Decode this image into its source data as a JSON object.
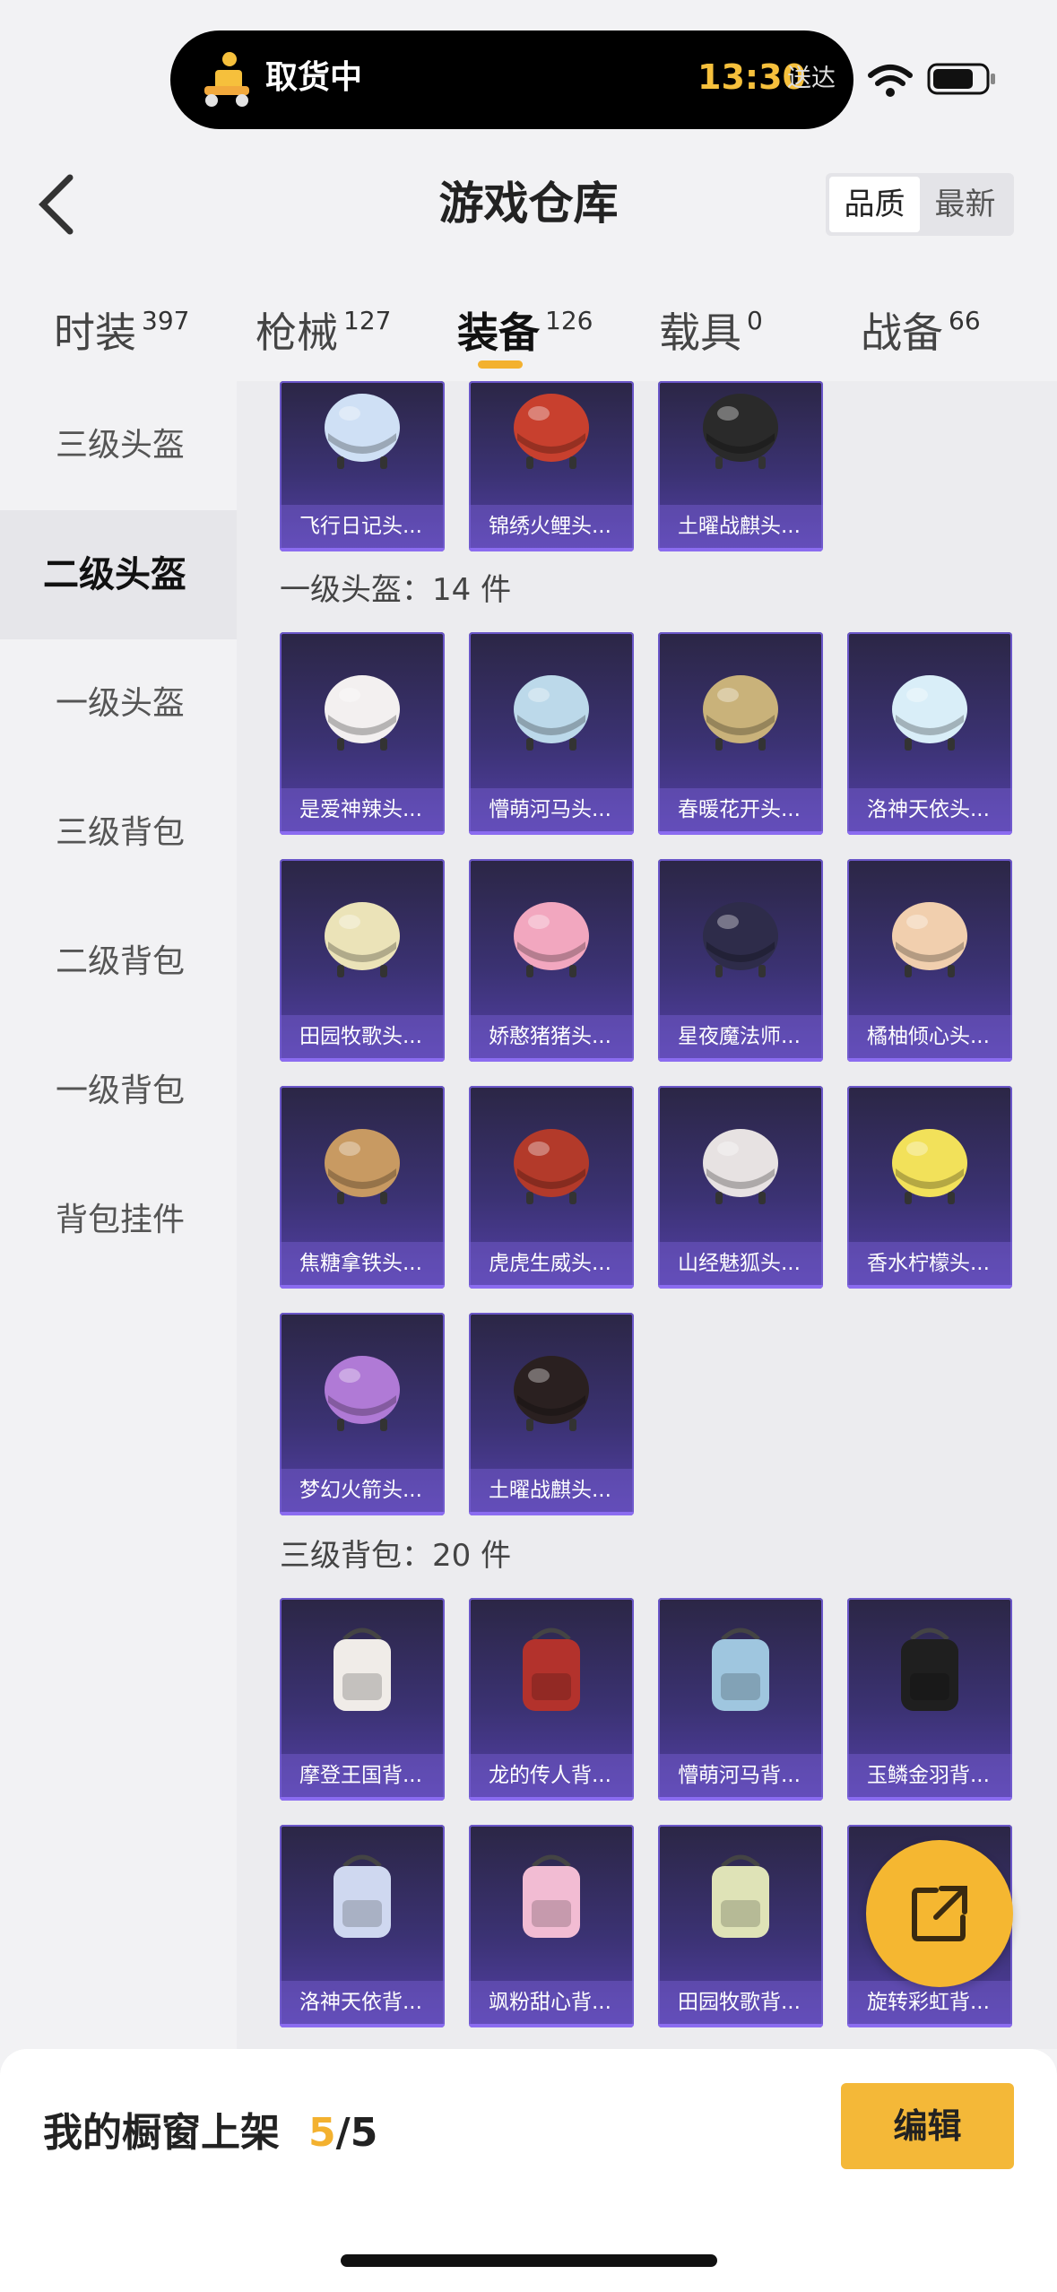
{
  "status": {
    "delivery_label": "取货中",
    "time": "13:30",
    "delivery_suffix": "送达"
  },
  "header": {
    "title": "游戏仓库",
    "sort_options": [
      "品质",
      "最新"
    ],
    "sort_active": "品质"
  },
  "tabs": [
    {
      "label": "时装",
      "count": "397"
    },
    {
      "label": "枪械",
      "count": "127"
    },
    {
      "label": "装备",
      "count": "126",
      "active": true
    },
    {
      "label": "载具",
      "count": "0"
    },
    {
      "label": "战备",
      "count": "66"
    }
  ],
  "sidebar": {
    "items": [
      "三级头盔",
      "二级头盔",
      "一级头盔",
      "三级背包",
      "二级背包",
      "一级背包",
      "背包挂件"
    ],
    "active": "二级头盔"
  },
  "sections": [
    {
      "title": "",
      "items": [
        "飞行日记头...",
        "锦绣火鲤头...",
        "土曜战麒头..."
      ]
    },
    {
      "title": "一级头盔：14 件",
      "items": [
        "是爱神辣头...",
        "懵萌河马头...",
        "春暖花开头...",
        "洛神天依头...",
        "田园牧歌头...",
        "娇憨猪猪头...",
        "星夜魔法师...",
        "橘柚倾心头...",
        "焦糖拿铁头...",
        "虎虎生威头...",
        "山经魅狐头...",
        "香水柠檬头...",
        "梦幻火箭头...",
        "土曜战麒头..."
      ]
    },
    {
      "title": "三级背包：20 件",
      "items": [
        "摩登王国背...",
        "龙的传人背...",
        "懵萌河马背...",
        "玉鳞金羽背...",
        "洛神天依背...",
        "飒粉甜心背...",
        "田园牧歌背...",
        "旋转彩虹背..."
      ]
    }
  ],
  "bottom": {
    "label": "我的橱窗上架",
    "current": "5",
    "total": "/5",
    "edit_label": "编辑"
  },
  "colors": {
    "accent": "#f3b12f",
    "card_bg": "#3b3273"
  },
  "icons": [
    "courier-icon",
    "wifi-icon",
    "battery-icon",
    "back-icon",
    "share-icon"
  ]
}
